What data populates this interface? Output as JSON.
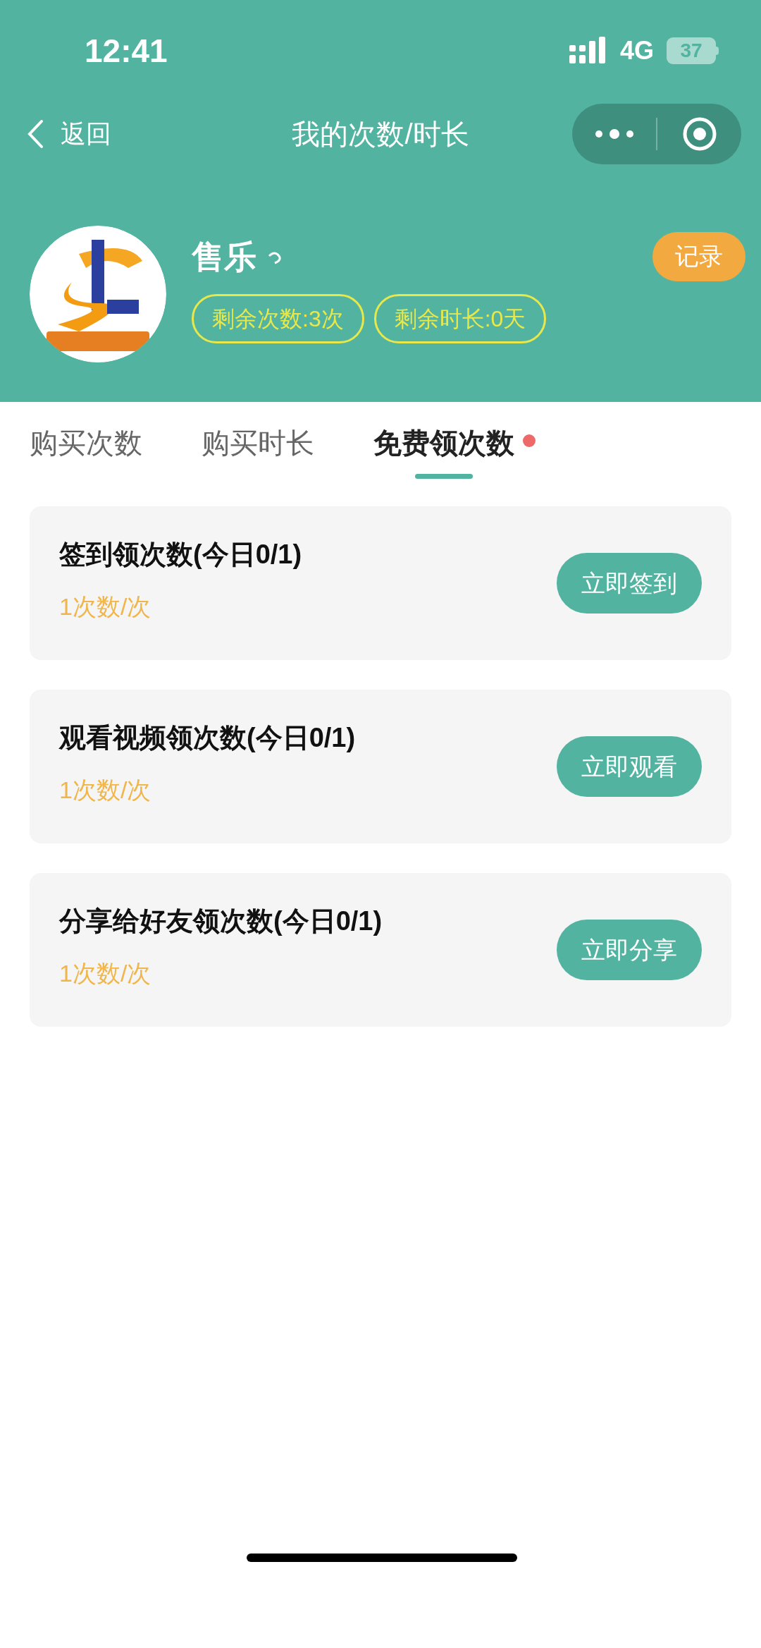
{
  "status_bar": {
    "time": "12:41",
    "network": "4G",
    "battery": "37"
  },
  "nav_bar": {
    "back_label": "返回",
    "title": "我的次数/时长"
  },
  "profile": {
    "name": "售乐",
    "record_button": "记录",
    "chips": [
      "剩余次数:3次",
      "剩余时长:0天"
    ]
  },
  "tabs": [
    {
      "label": "购买次数",
      "selected": false,
      "dot": false
    },
    {
      "label": "购买时长",
      "selected": false,
      "dot": false
    },
    {
      "label": "免费领次数",
      "selected": true,
      "dot": true
    }
  ],
  "tasks": [
    {
      "title": "签到领次数(今日0/1)",
      "reward": "1次数/次",
      "button": "立即签到"
    },
    {
      "title": "观看视频领次数(今日0/1)",
      "reward": "1次数/次",
      "button": "立即观看"
    },
    {
      "title": "分享给好友领次数(今日0/1)",
      "reward": "1次数/次",
      "button": "立即分享"
    }
  ]
}
